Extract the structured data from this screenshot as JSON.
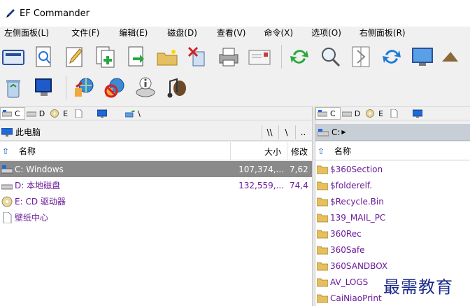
{
  "window": {
    "title": "EF Commander"
  },
  "menu": [
    {
      "label": "左侧面板(L)"
    },
    {
      "label": "文件(F)"
    },
    {
      "label": "编辑(E)"
    },
    {
      "label": "磁盘(D)"
    },
    {
      "label": "查看(V)"
    },
    {
      "label": "命令(X)"
    },
    {
      "label": "选项(O)"
    },
    {
      "label": "右侧面板(R)"
    }
  ],
  "toolbar1": [
    "drive-window-icon",
    "find-icon",
    "edit-pencil-icon",
    "copy-document-icon",
    "move-document-icon",
    "new-folder-icon",
    "delete-icon",
    "print-icon",
    "mail-icon",
    "refresh-icon",
    "search-icon",
    "compare-icon",
    "sync-icon",
    "monitor-icon",
    "up-icon"
  ],
  "toolbar2": [
    "recycle-bin-icon",
    "computer-icon",
    "network-connect-icon",
    "network-disconnect-icon",
    "disk-info-icon",
    "music-icon"
  ],
  "left_panel": {
    "drives": [
      {
        "label": "C",
        "type": "hdd",
        "active": true
      },
      {
        "label": "D",
        "type": "hdd",
        "active": false
      },
      {
        "label": "E",
        "type": "cd",
        "active": false
      },
      {
        "label": "",
        "type": "file",
        "active": false
      },
      {
        "label": "",
        "type": "monitor",
        "active": false
      },
      {
        "label": "\\",
        "type": "network",
        "active": false
      }
    ],
    "path": "此电脑",
    "path_btn1": "\\\\",
    "path_btn2": "\\",
    "path_btn3": "..",
    "columns": {
      "name": "名称",
      "size": "大小",
      "modified": "修改"
    },
    "rows": [
      {
        "name": "C: Windows",
        "size": "107,374,...",
        "modified": "7,62",
        "icon": "hdd",
        "selected": true
      },
      {
        "name": "D: 本地磁盘",
        "size": "132,559,...",
        "modified": "74,4",
        "icon": "hdd",
        "selected": false
      },
      {
        "name": "E: CD 驱动器",
        "size": "",
        "modified": "",
        "icon": "cd",
        "selected": false
      },
      {
        "name": "壁纸中心",
        "size": "",
        "modified": "",
        "icon": "file",
        "selected": false
      }
    ]
  },
  "right_panel": {
    "drives": [
      {
        "label": "C",
        "type": "hdd",
        "active": true
      },
      {
        "label": "D",
        "type": "hdd",
        "active": false
      },
      {
        "label": "E",
        "type": "cd",
        "active": false
      },
      {
        "label": "",
        "type": "file",
        "active": false
      },
      {
        "label": "",
        "type": "monitor",
        "active": false
      }
    ],
    "path": "C:",
    "columns": {
      "name": "名称"
    },
    "rows": [
      {
        "name": "$360Section"
      },
      {
        "name": "$folderelf."
      },
      {
        "name": "$Recycle.Bin"
      },
      {
        "name": "139_MAIL_PC"
      },
      {
        "name": "360Rec"
      },
      {
        "name": "360Safe"
      },
      {
        "name": "360SANDBOX"
      },
      {
        "name": "AV_LOGS"
      },
      {
        "name": "CaiNiaoPrint"
      }
    ]
  },
  "watermark": "最需教育"
}
